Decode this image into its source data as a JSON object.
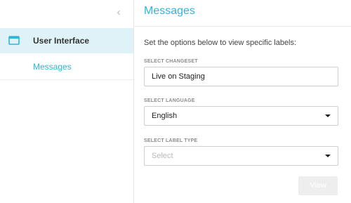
{
  "sidebar": {
    "collapse_glyph": "‹",
    "item": {
      "label": "User Interface",
      "icon": "window-icon"
    },
    "sub_item": {
      "label": "Messages"
    }
  },
  "main": {
    "title": "Messages",
    "intro": "Set the options below to view specific labels:",
    "changeset": {
      "label": "SELECT CHANGESET",
      "value": "Live on Staging"
    },
    "language": {
      "label": "SELECT LANGUAGE",
      "value": "English"
    },
    "label_type": {
      "label": "SELECT LABEL TYPE",
      "placeholder": "Select"
    },
    "view_button": "View"
  },
  "colors": {
    "accent": "#2fb6d8",
    "active_bg": "#dff2f8",
    "disabled_button": "#eeeeee"
  }
}
